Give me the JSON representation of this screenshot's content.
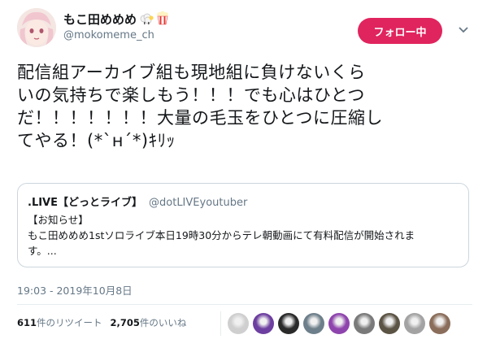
{
  "author": {
    "name": "もこ田めめめ",
    "emojis": [
      "sheep-emoji",
      "popcorn-emoji"
    ],
    "handle": "@mokomeme_ch",
    "avatar": "avatar-image"
  },
  "follow_button": {
    "label": "フォロー中"
  },
  "tweet": {
    "text": "配信組アーカイブ組も現地組に負けないくら\nいの気持ちで楽しもう！！！でも心はひとつ\nだ！！！！！！！大量の毛玉をひとつに圧縮し\nてやる！(*`н´*)ｷﾘｯ"
  },
  "quote": {
    "name": ".LIVE【どっとライブ】",
    "handle": "@dotLIVEyoutuber",
    "body": "【お知らせ】\nもこ田めめめ1stソロライブ本日19時30分からテレ朝動画にて有料配信が開始されま\nす。..."
  },
  "timestamp": "19:03 - 2019年10月8日",
  "stats": {
    "retweets_count": "611",
    "retweets_label": "件のリツイート",
    "likes_count": "2,705",
    "likes_label": "件のいいね"
  },
  "likers": [
    {
      "color": "#cfcfcf"
    },
    {
      "color": "#6d3fa0"
    },
    {
      "color": "#2a2a2a"
    },
    {
      "color": "#6d7f8a"
    },
    {
      "color": "#8e44ad"
    },
    {
      "color": "#7a7a7a"
    },
    {
      "color": "#5b5344"
    },
    {
      "color": "#a3a3a3"
    },
    {
      "color": "#8a6d5a"
    }
  ],
  "colors": {
    "accent": "#e0245e",
    "muted": "#657786",
    "border": "#ccd6dd"
  }
}
